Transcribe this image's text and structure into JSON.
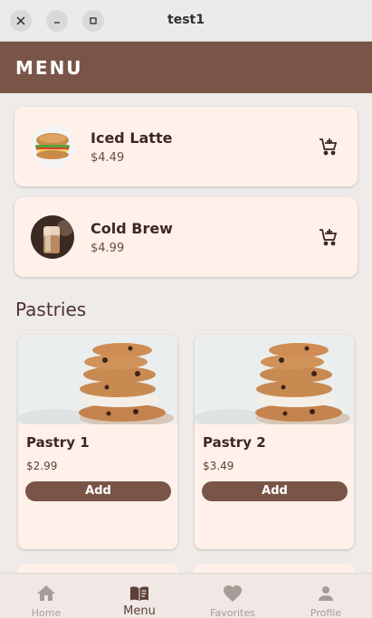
{
  "window": {
    "title": "test1",
    "close_icon": "close-icon",
    "minimize_icon": "minimize-icon",
    "maximize_icon": "maximize-icon"
  },
  "appbar": {
    "title": "MENU"
  },
  "coffees": [
    {
      "name": "Iced Latte",
      "price": "$4.49",
      "image": "sandwich-photo",
      "cart_icon": "add-to-cart-icon"
    },
    {
      "name": "Cold Brew",
      "price": "$4.99",
      "image": "cold-brew-photo",
      "cart_icon": "add-to-cart-icon"
    }
  ],
  "pastries_section": {
    "title": "Pastries"
  },
  "pastries": [
    {
      "name": "Pastry 1",
      "price": "$2.99",
      "button": "Add",
      "image": "cookie-stack-photo"
    },
    {
      "name": "Pastry 2",
      "price": "$3.49",
      "button": "Add",
      "image": "cookie-stack-photo"
    }
  ],
  "bottom_nav": {
    "items": [
      {
        "label": "Home",
        "icon": "home-icon",
        "active": false
      },
      {
        "label": "Menu",
        "icon": "menu-book-icon",
        "active": true
      },
      {
        "label": "Favorites",
        "icon": "heart-icon",
        "active": false
      },
      {
        "label": "Profile",
        "icon": "person-icon",
        "active": false
      }
    ]
  },
  "colors": {
    "primary": "#795548",
    "card": "#fff1ea",
    "background": "#efebe9",
    "text": "#3e2723"
  }
}
